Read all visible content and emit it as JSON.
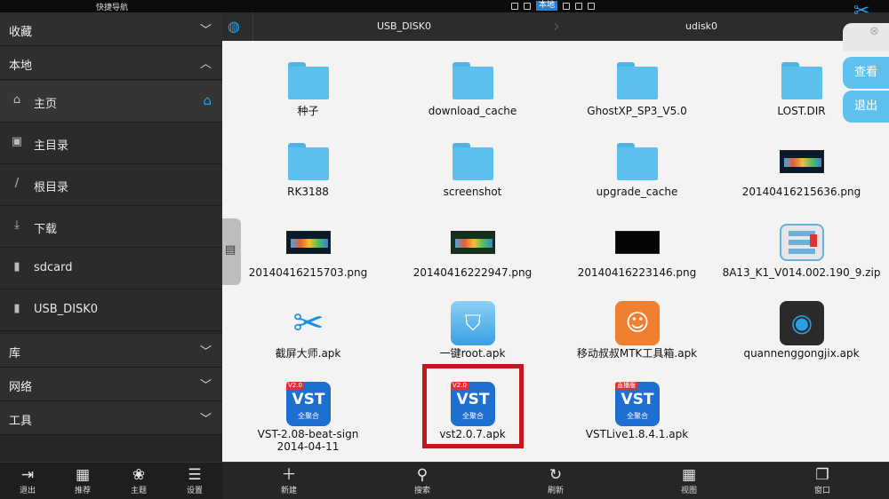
{
  "statusbar": {
    "left_title": "快捷导航",
    "active_tab": "本地"
  },
  "sidebar": {
    "sections": {
      "favorites": "收藏",
      "local": "本地",
      "library": "库",
      "network": "网络",
      "tools": "工具"
    },
    "items": [
      {
        "label": "主页",
        "icon": "home-icon"
      },
      {
        "label": "主目录",
        "icon": "folder-camera-icon"
      },
      {
        "label": "根目录",
        "icon": "slash-icon"
      },
      {
        "label": "下载",
        "icon": "download-icon"
      },
      {
        "label": "sdcard",
        "icon": "sdcard-icon"
      },
      {
        "label": "USB_DISK0",
        "icon": "usb-drive-icon"
      }
    ],
    "bottom": [
      "退出",
      "推荐",
      "主题",
      "设置"
    ]
  },
  "pathbar": {
    "crumbs": [
      "USB_DISK0",
      "udisk0"
    ]
  },
  "files": [
    {
      "name": "种子",
      "type": "folder"
    },
    {
      "name": "download_cache",
      "type": "folder"
    },
    {
      "name": "GhostXP_SP3_V5.0",
      "type": "folder"
    },
    {
      "name": "LOST.DIR",
      "type": "folder"
    },
    {
      "name": "RK3188",
      "type": "folder"
    },
    {
      "name": "screenshot",
      "type": "folder"
    },
    {
      "name": "upgrade_cache",
      "type": "folder"
    },
    {
      "name": "20140416215636.png",
      "type": "image"
    },
    {
      "name": "20140416215703.png",
      "type": "image"
    },
    {
      "name": "20140416222947.png",
      "type": "image"
    },
    {
      "name": "20140416223146.png",
      "type": "image"
    },
    {
      "name": "8A13_K1_V014.002.190_9.zip",
      "type": "zip"
    },
    {
      "name": "截屏大师.apk",
      "type": "apk"
    },
    {
      "name": "一键root.apk",
      "type": "apk"
    },
    {
      "name": "移动叔叔MTK工具箱.apk",
      "type": "apk"
    },
    {
      "name": "quannenggongjix.apk",
      "type": "apk"
    },
    {
      "name": "VST-2.08-beat-sign\n2014-04-11",
      "type": "apk"
    },
    {
      "name": "vst2.0.7.apk",
      "type": "apk"
    },
    {
      "name": "VSTLive1.8.4.1.apk",
      "type": "apk"
    }
  ],
  "vst": {
    "logo": "VST",
    "sub": "全聚合",
    "tag1": "V2.0",
    "tag2": "直播版"
  },
  "main_bottom": [
    "新建",
    "搜索",
    "刷新",
    "视图",
    "窗口"
  ],
  "floating": {
    "view": "查看",
    "exit": "退出"
  },
  "colors": {
    "accent": "#2a9fe6",
    "highlight": "#c0181c",
    "folder": "#5cbfee"
  }
}
